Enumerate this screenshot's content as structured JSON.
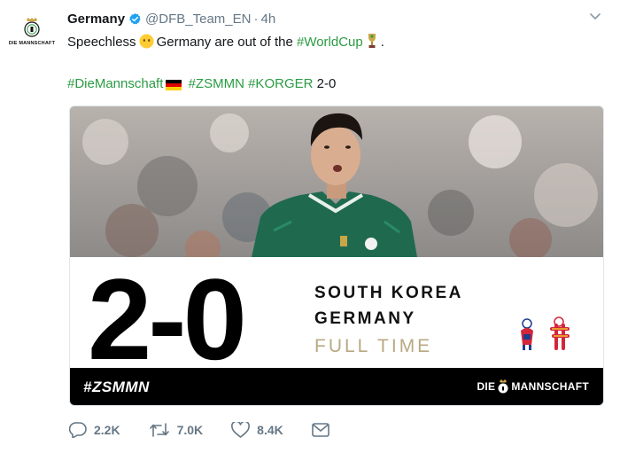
{
  "tweet": {
    "author_name": "Germany",
    "handle": "@DFB_Team_EN",
    "separator": "·",
    "time": "4h",
    "avatar_text": "DIE MANNSCHAFT",
    "line1_prefix": "Speechless",
    "line1_middle": "Germany are out of the",
    "line1_hashtag": "#WorldCup",
    "line1_suffix": ".",
    "line2_hashtag1": "#DieMannschaft",
    "line2_hashtag2": "#ZSMMN",
    "line2_hashtag3": "#KORGER",
    "line2_score": "2-0"
  },
  "card": {
    "score": "2-0",
    "team1": "SOUTH KOREA",
    "team2": "GERMANY",
    "status": "FULL TIME",
    "banner_hashtag": "#ZSMMN",
    "brand_left": "DIE",
    "brand_right": "MANNSCHAFT"
  },
  "actions": {
    "replies": "2.2K",
    "retweets": "7.0K",
    "likes": "8.4K"
  },
  "icons": {
    "verified": "verified-badge-icon",
    "caret": "chevron-down-icon",
    "reply": "reply-icon",
    "retweet": "retweet-icon",
    "like": "heart-icon",
    "dm": "envelope-icon"
  },
  "colors": {
    "hashtag": "#2a9c43",
    "meta": "#657786",
    "verified": "#1da1f2",
    "fulltime": "#b9a983"
  }
}
